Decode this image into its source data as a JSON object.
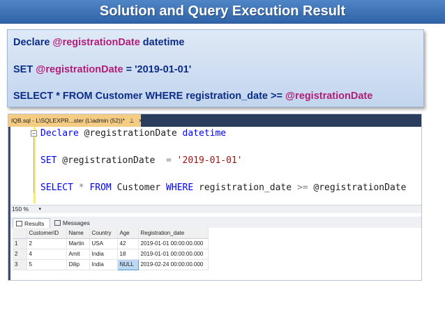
{
  "slide": {
    "title": "Solution and Query Execution Result"
  },
  "callout": {
    "line1": {
      "kw": "Declare ",
      "var": "@registrationDate",
      "rest": " datetime"
    },
    "line2": {
      "kw": "SET ",
      "var": "@registrationDate",
      "rest": "  = '2019-01-01'"
    },
    "line3": {
      "kw": "SELECT * FROM Customer WHERE registration_date >= ",
      "var": "@registrationDate"
    }
  },
  "ssms": {
    "tab_title": "IQB.sql - L\\SQLEXPR...ster (L\\admin (52))*",
    "tab_pin": "⊥",
    "tab_close": "×",
    "code": {
      "l1_kw": "Declare",
      "l1_var": " @registrationDate ",
      "l1_type": "datetime",
      "l2_kw": "SET",
      "l2_var": " @registrationDate  ",
      "l2_op": "=",
      "l2_str": " '2019-01-01'",
      "l3_kw1": "SELECT",
      "l3_op1": " * ",
      "l3_kw2": "FROM",
      "l3_t1": " Customer ",
      "l3_kw3": "WHERE",
      "l3_t2": " registration_date ",
      "l3_op2": ">=",
      "l3_var": " @registrationDate"
    },
    "zoom": "150 %",
    "zoom_arrow": "▾",
    "results_tab": "Results",
    "messages_tab": "Messages",
    "columns": [
      "",
      "CustomerID",
      "Name",
      "Country",
      "Age",
      "Registration_date"
    ],
    "rows": [
      [
        "1",
        "2",
        "Martin",
        "USA",
        "42",
        "2019-01-01 00:00:00.000"
      ],
      [
        "2",
        "4",
        "Amit",
        "India",
        "18",
        "2019-01-01 00:00:00.000"
      ],
      [
        "3",
        "5",
        "Dilip",
        "India",
        "NULL",
        "2019-02-24 00:00:00.000"
      ]
    ]
  }
}
